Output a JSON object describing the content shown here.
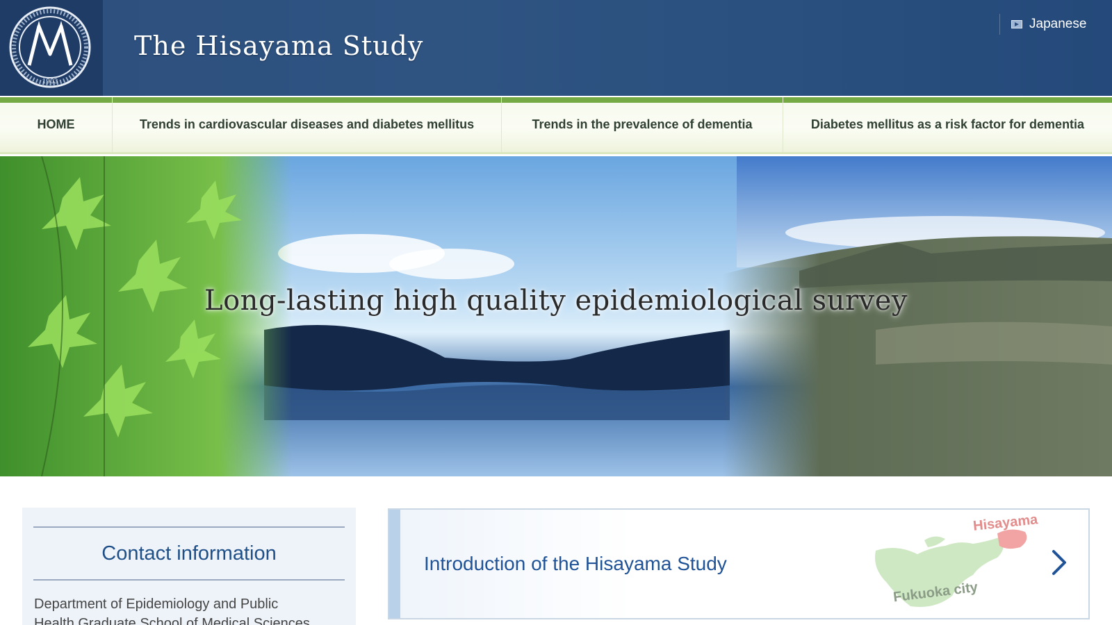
{
  "header": {
    "title": "The Hisayama Study",
    "logo_icon": "university-seal-logo",
    "language_label": "Japanese",
    "language_icon": "play-square-icon"
  },
  "nav": {
    "items": [
      {
        "label": "HOME"
      },
      {
        "label": "Trends in cardiovascular diseases and diabetes mellitus"
      },
      {
        "label": "Trends in the prevalence of dementia"
      },
      {
        "label": "Diabetes mellitus as a risk factor for dementia"
      }
    ],
    "accent_color": "#74a943"
  },
  "hero": {
    "caption": "Long-lasting high quality epidemiological survey"
  },
  "contact": {
    "title": "Contact information",
    "line1": "Department of Epidemiology and Public",
    "line2": "Health Graduate School of Medical Sciences"
  },
  "intro": {
    "title": "Introduction of the Hisayama Study",
    "map_label_town": "Hisayama",
    "map_label_city": "Fukuoka city",
    "chevron_icon": "chevron-right-icon"
  },
  "colors": {
    "header_blue": "#2d4f7e",
    "link_blue": "#1f5296",
    "nav_green": "#74a943"
  }
}
